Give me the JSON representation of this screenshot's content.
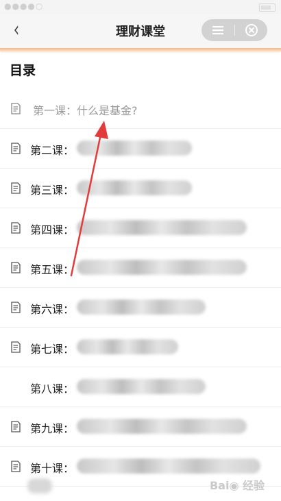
{
  "navbar": {
    "title": "理财课堂",
    "back_icon": "chevron-left-icon",
    "menu_icon": "hamburger-icon",
    "close_icon": "close-circle-icon"
  },
  "toc": {
    "title": "目录"
  },
  "lessons": [
    {
      "label": "第一课：什么是基金?"
    },
    {
      "label": "第二课："
    },
    {
      "label": "第三课："
    },
    {
      "label": "第四课："
    },
    {
      "label": "第五课："
    },
    {
      "label": "第六课："
    },
    {
      "label": "第七课："
    },
    {
      "label": "第八课："
    },
    {
      "label": "第九课："
    },
    {
      "label": "第十课："
    }
  ],
  "colors": {
    "accent": "#f3b583",
    "annotation_arrow": "#e23b3b"
  }
}
